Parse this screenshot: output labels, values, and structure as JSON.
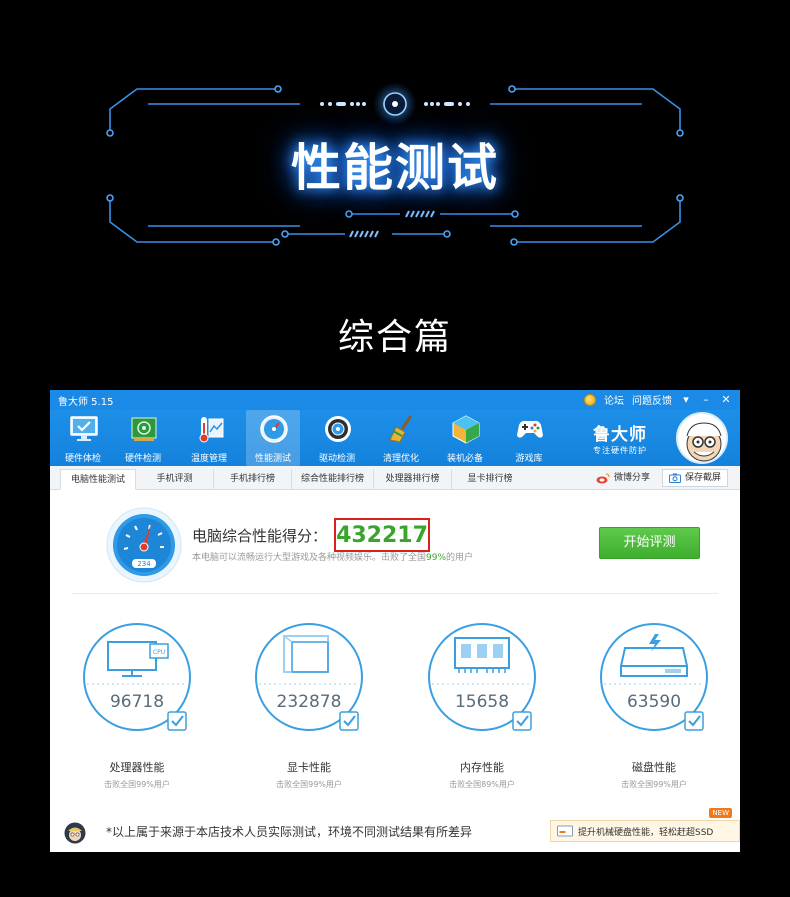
{
  "banner": {
    "title": "性能测试",
    "section": "综合篇"
  },
  "app": {
    "title": "鲁大师 5.15",
    "title_links": [
      "论坛",
      "问题反馈"
    ],
    "window_controls": [
      "▾",
      "–",
      "✕"
    ],
    "toolbar": [
      {
        "label": "硬件体检",
        "icon": "monitor-check-icon"
      },
      {
        "label": "硬件检测",
        "icon": "circuit-board-icon"
      },
      {
        "label": "温度管理",
        "icon": "thermometer-icon"
      },
      {
        "label": "性能测试",
        "icon": "speedometer-icon"
      },
      {
        "label": "驱动检测",
        "icon": "gear-disc-icon"
      },
      {
        "label": "清理优化",
        "icon": "broom-icon"
      },
      {
        "label": "装机必备",
        "icon": "package-cube-icon"
      },
      {
        "label": "游戏库",
        "icon": "gamepad-icon"
      }
    ],
    "brand": {
      "name": "鲁大师",
      "sub": "专注硬件防护"
    },
    "tabs": [
      "电脑性能测试",
      "手机评测",
      "手机排行榜",
      "综合性能排行榜",
      "处理器排行榜",
      "显卡排行榜"
    ],
    "tab_actions": {
      "share": "微博分享",
      "save": "保存截屏"
    },
    "gauge_digits": "234",
    "score": {
      "label": "电脑综合性能得分：",
      "value": "432217",
      "desc_prefix": "本电脑可以流畅运行大型游戏及各种视频娱乐。击败了全国",
      "desc_pct": "99%",
      "desc_suffix": "的用户"
    },
    "start_button": "开始评测",
    "metrics": [
      {
        "value": "96718",
        "name": "处理器性能",
        "sub": "击败全国99%用户",
        "icon": "cpu-monitor-icon",
        "chip_text": "CPU"
      },
      {
        "value": "232878",
        "name": "显卡性能",
        "sub": "击败全国99%用户",
        "icon": "gpu-cube-icon"
      },
      {
        "value": "15658",
        "name": "内存性能",
        "sub": "击败全国89%用户",
        "icon": "memory-chip-icon"
      },
      {
        "value": "63590",
        "name": "磁盘性能",
        "sub": "击败全国99%用户",
        "icon": "hard-disk-icon"
      }
    ],
    "footer_note": "*以上属于来源于本店技术人员实际测试，环境不同测试结果有所差异",
    "promo": {
      "badge": "NEW",
      "text": "提升机械硬盘性能，轻松赶超SSD"
    },
    "colors": {
      "accent": "#1a8ae6",
      "score_green": "#3aa52c",
      "ring_blue": "#3a9fe0",
      "score_border": "#d9201c"
    }
  }
}
